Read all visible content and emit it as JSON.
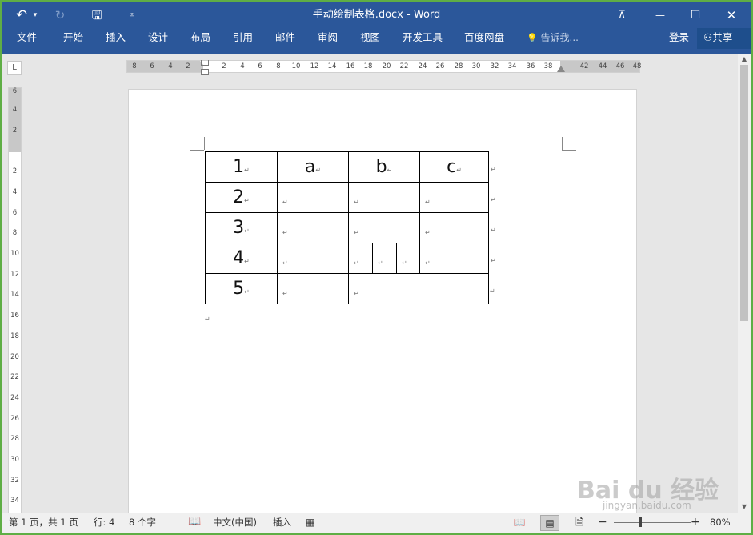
{
  "window": {
    "title": "手动绘制表格.docx - Word"
  },
  "quick_access": {
    "undo_icon": "↶",
    "undo_dropdown": "▾",
    "redo_icon": "↻",
    "save_icon": "🖫",
    "customize_icon": "⩡"
  },
  "window_controls": {
    "ribbon_display": "⊼",
    "minimize": "—",
    "maximize": "☐",
    "close": "✕"
  },
  "ribbon": {
    "tabs": [
      "文件",
      "开始",
      "插入",
      "设计",
      "布局",
      "引用",
      "邮件",
      "审阅",
      "视图",
      "开发工具",
      "百度网盘"
    ],
    "tell_me": "告诉我...",
    "login": "登录",
    "share": "共享"
  },
  "ruler": {
    "corner": "L",
    "horizontal": [
      "8",
      "6",
      "4",
      "2",
      "2",
      "4",
      "6",
      "8",
      "10",
      "12",
      "14",
      "16",
      "18",
      "20",
      "22",
      "24",
      "26",
      "28",
      "30",
      "32",
      "34",
      "36",
      "38",
      "42",
      "44",
      "46",
      "48"
    ],
    "vertical": [
      "6",
      "4",
      "2",
      "2",
      "4",
      "6",
      "8",
      "10",
      "12",
      "14",
      "16",
      "18",
      "20",
      "22",
      "24",
      "26",
      "28",
      "30",
      "32",
      "34"
    ]
  },
  "table": {
    "rows": [
      {
        "label": "1",
        "cells": [
          "a",
          "b",
          "c"
        ]
      },
      {
        "label": "2",
        "cells": [
          "",
          "",
          ""
        ]
      },
      {
        "label": "3",
        "cells": [
          "",
          "",
          ""
        ]
      },
      {
        "label": "4",
        "cells": [
          "",
          "",
          "",
          "",
          ""
        ]
      },
      {
        "label": "5",
        "cells": [
          "",
          ""
        ]
      }
    ],
    "paragraph_mark": "↵"
  },
  "status_bar": {
    "page": "第 1 页，共 1 页",
    "line": "行: 4",
    "words": "8 个字",
    "language": "中文(中国)",
    "mode": "插入",
    "zoom": "80%",
    "zoom_minus": "−",
    "zoom_plus": "+"
  },
  "watermark": {
    "brand": "Bai du 经验",
    "url": "jingyan.baidu.com"
  }
}
